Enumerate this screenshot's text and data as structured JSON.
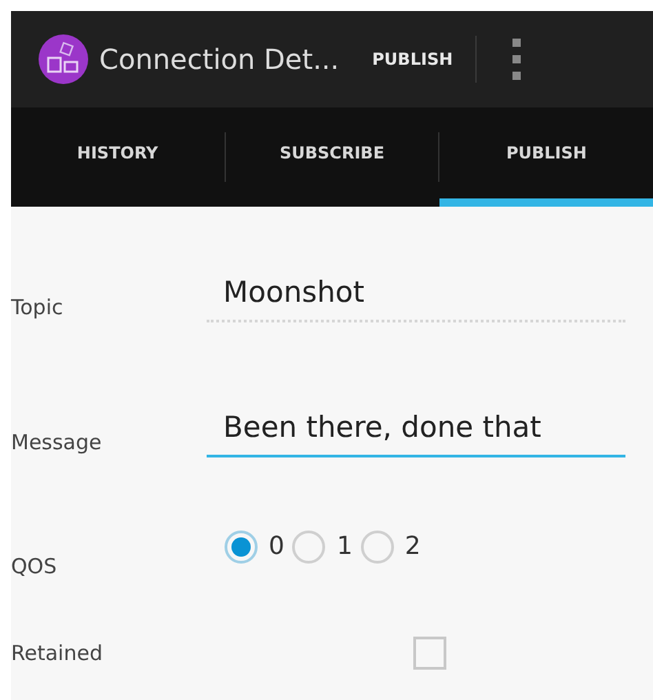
{
  "action_bar": {
    "title": "Connection Det...",
    "action": "PUBLISH"
  },
  "tabs": [
    {
      "label": "HISTORY",
      "selected": false
    },
    {
      "label": "SUBSCRIBE",
      "selected": false
    },
    {
      "label": "PUBLISH",
      "selected": true
    }
  ],
  "form": {
    "topic": {
      "label": "Topic",
      "value": "Moonshot",
      "focused": false
    },
    "message": {
      "label": "Message",
      "value": "Been there, done that",
      "focused": true
    },
    "qos": {
      "label": "QOS",
      "options": [
        {
          "label": "0",
          "selected": true
        },
        {
          "label": "1",
          "selected": false
        },
        {
          "label": "2",
          "selected": false
        }
      ]
    },
    "retained": {
      "label": "Retained",
      "checked": false
    }
  }
}
